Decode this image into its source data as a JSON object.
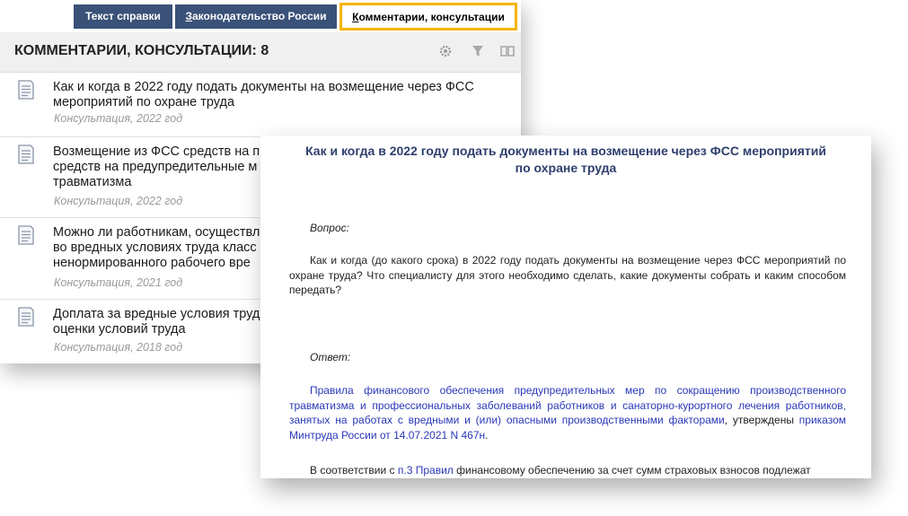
{
  "tabs": [
    {
      "label": "Текст справки",
      "active": false
    },
    {
      "label": "Законодательство России",
      "underline_char": "З",
      "rest": "аконодательство России",
      "active": false
    },
    {
      "label": "Комментарии, консультации",
      "underline_char": "К",
      "rest": "омментарии, консультации",
      "active": true
    }
  ],
  "header": {
    "title": "КОММЕНТАРИИ, КОНСУЛЬТАЦИИ: 8",
    "icons": [
      "gear-icon",
      "filter-icon",
      "book-icon"
    ]
  },
  "list": [
    {
      "title": "Как и когда в 2022 году подать документы на возмещение через ФСС мероприятий по охране труда",
      "subtitle": "Консультация, 2022 год"
    },
    {
      "title": "Возмещение из ФСС средств на предупредительные меры по сокращению производственного травматизма",
      "title_visible": "Возмещение из ФСС средств на п\nсредств на предупредительные м\nтравматизма",
      "subtitle": "Консультация, 2022 год"
    },
    {
      "title_visible": "Можно ли работникам, осуществл\nво вредных условиях труда класс\nненормированного рабочего вре",
      "subtitle": "Консультация, 2021 год"
    },
    {
      "title_visible": "Доплата за вредные условия труд\nоценки условий труда",
      "subtitle": "Консультация, 2018 год"
    }
  ],
  "document": {
    "title": "Как и когда в 2022 году подать документы на возмещение через ФСС мероприятий по охране труда",
    "question_label": "Вопрос:",
    "question_text": "Как и когда (до какого срока) в 2022 году подать документы на возмещение через ФСС мероприятий по охране труда? Что специалисту для этого необходимо сделать, какие документы собрать и каким способом передать?",
    "answer_label": "Ответ:",
    "answer_link1": "Правила финансового обеспечения предупредительных мер по сокращению производственного травматизма и профессиональных заболеваний работников и санаторно-курортного лечения работников, занятых на работах с вредными и (или) опасными производственными факторами",
    "answer_mid": ", утверждены ",
    "answer_link2": "приказом Минтруда России от 14.07.2021 N 467н",
    "answer_end": ".",
    "p2_start": "В соответствии с ",
    "p2_link": "п.3 Правил",
    "p2_rest": " финансовому обеспечению за счет сумм страховых взносов подлежат"
  },
  "colors": {
    "tab_bg": "#3a5178",
    "tab_active_border": "#f5b400",
    "doc_title": "#2e3f6e",
    "link": "#2a38b8"
  }
}
